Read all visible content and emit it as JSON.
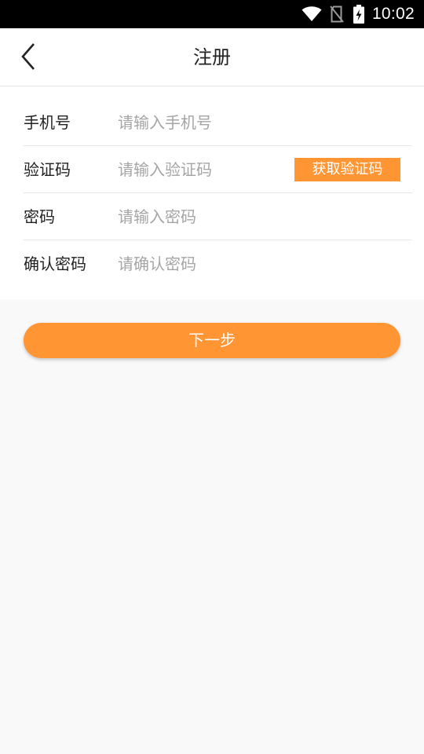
{
  "status_bar": {
    "time": "10:02",
    "icons": [
      "wifi-icon",
      "no-sim-icon",
      "battery-charging-icon"
    ]
  },
  "header": {
    "back_icon": "chevron-left-icon",
    "title": "注册"
  },
  "form": {
    "phone": {
      "label": "手机号",
      "placeholder": "请输入手机号"
    },
    "code": {
      "label": "验证码",
      "placeholder": "请输入验证码",
      "button_label": "获取验证码"
    },
    "password": {
      "label": "密码",
      "placeholder": "请输入密码"
    },
    "confirm": {
      "label": "确认密码",
      "placeholder": "请确认密码"
    }
  },
  "actions": {
    "next_label": "下一步"
  },
  "colors": {
    "accent": "#ff9533",
    "status_bar": "#000000",
    "background": "#f9f9f9",
    "divider": "#e6e6e6",
    "placeholder": "#a5a5a5"
  }
}
